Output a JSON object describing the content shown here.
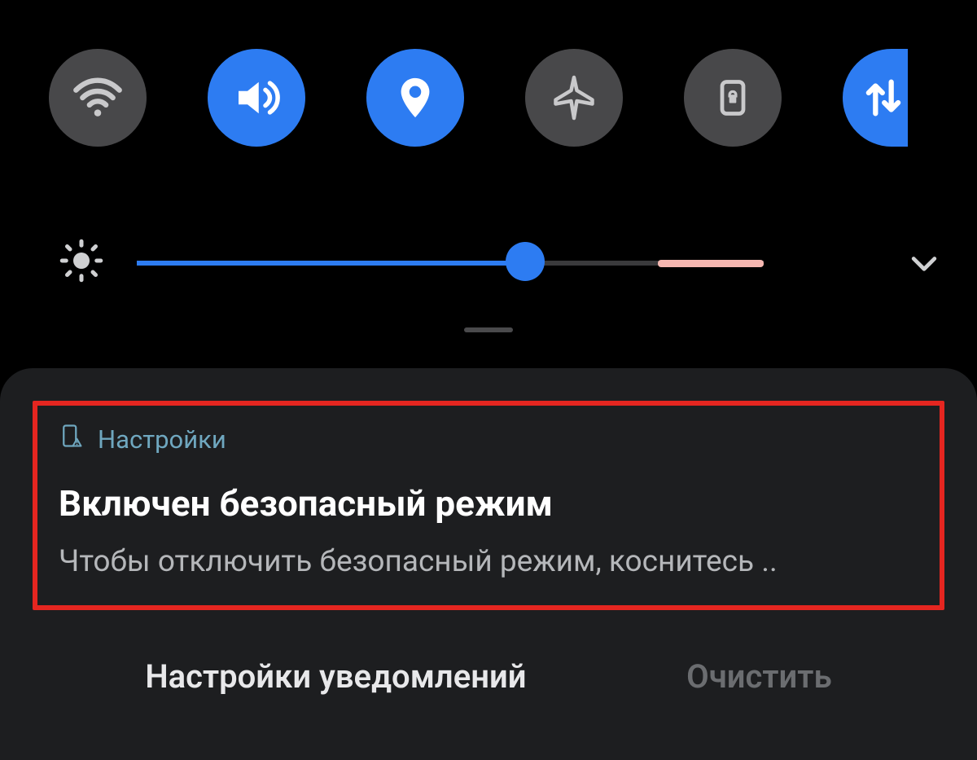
{
  "colors": {
    "accent": "#2d7cf2",
    "tile_off": "#48484a",
    "highlight_border": "#e52620"
  },
  "quick_tiles": [
    {
      "name": "wifi",
      "active": false,
      "icon": "wifi-icon"
    },
    {
      "name": "sound",
      "active": true,
      "icon": "sound-icon"
    },
    {
      "name": "location",
      "active": true,
      "icon": "location-icon"
    },
    {
      "name": "airplane-mode",
      "active": false,
      "icon": "airplane-icon"
    },
    {
      "name": "rotation-lock",
      "active": false,
      "icon": "rotation-lock-icon"
    },
    {
      "name": "mobile-data",
      "active": true,
      "icon": "data-transfer-icon"
    }
  ],
  "brightness": {
    "value_percent": 62,
    "auto_icon": "brightness-icon",
    "expand_icon": "chevron-down-icon"
  },
  "notification": {
    "source_app": "Настройки",
    "source_icon": "phone-warning-icon",
    "title": "Включен безопасный режим",
    "body": "Чтобы отключить безопасный режим, коснитесь ..",
    "highlighted": true
  },
  "footer": {
    "settings_label": "Настройки уведомлений",
    "clear_label": "Очистить",
    "clear_enabled": false
  }
}
